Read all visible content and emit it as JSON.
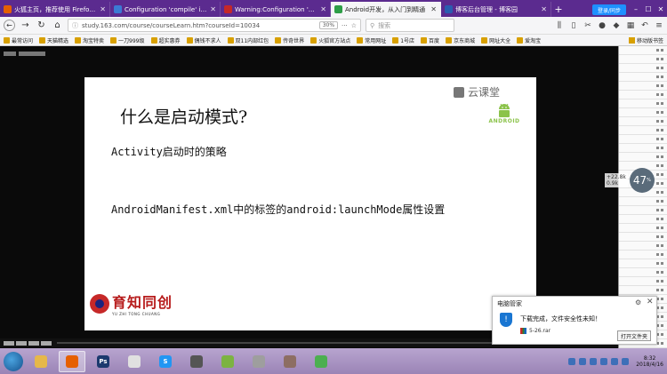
{
  "tabs": [
    {
      "label": "火狐主页，推荐使用 Firefox 浏",
      "color": "#e66000",
      "active": false
    },
    {
      "label": "Configuration 'compile' is ob",
      "color": "#3b7bd4",
      "active": false
    },
    {
      "label": "Warning:Configuration 'com",
      "color": "#c62828",
      "active": false
    },
    {
      "label": "Android开发，从入门到精通",
      "color": "#2e9e47",
      "active": true
    },
    {
      "label": "博客后台管理 - 博客园",
      "color": "#2a5db0",
      "active": false
    }
  ],
  "sync_label": "登录/同步",
  "address": {
    "url": "study.163.com/course/courseLearn.htm?courseId=10034",
    "zoom": "30%"
  },
  "search": {
    "placeholder": "搜索"
  },
  "bookmarks": [
    "最常访问",
    "天猫精选",
    "淘宝特卖",
    "一刀999级",
    "超实惠券",
    "偶钱不求人",
    "双11内部红包",
    "传奇世界",
    "火狐官方站点",
    "常用网址",
    "1号店",
    "百度",
    "京东商城",
    "网址大全",
    "爱淘宝"
  ],
  "bookmark_right": "移动版书签",
  "slide": {
    "title": "什么是启动模式?",
    "line1": "Activity启动时的策略",
    "line2": "AndroidManifest.xml中的标签的android:launchMode属性设置",
    "logo": "云课堂",
    "android_word": "ANDROID",
    "brand_cn": "育知同创",
    "brand_en": "YU ZHI TONG CHUANG"
  },
  "speed": {
    "up": "+22.8k",
    "down": "0.9k",
    "percent": "47",
    "unit": "%"
  },
  "notification": {
    "title": "电脑管家",
    "message": "下载完成，文件安全性未知！",
    "file": "5-26.rar",
    "open_button": "打开文件夹"
  },
  "taskbar": {
    "apps": [
      {
        "name": "explorer",
        "label": "",
        "color": "#e6b84a",
        "active": false
      },
      {
        "name": "firefox",
        "label": "",
        "color": "#e66000",
        "active": true
      },
      {
        "name": "photoshop",
        "label": "Ps",
        "color": "#1c3a6e",
        "active": false
      },
      {
        "name": "player",
        "label": "",
        "color": "#e0e0e0",
        "active": false
      },
      {
        "name": "sogou",
        "label": "S",
        "color": "#2196f3",
        "active": false
      },
      {
        "name": "app6",
        "label": "",
        "color": "#555",
        "active": false
      },
      {
        "name": "android-studio",
        "label": "",
        "color": "#7cb342",
        "active": false
      },
      {
        "name": "app8",
        "label": "",
        "color": "#9e9e9e",
        "active": false
      },
      {
        "name": "app9",
        "label": "",
        "color": "#8d6e63",
        "active": false
      },
      {
        "name": "wechat",
        "label": "",
        "color": "#4caf50",
        "active": false
      }
    ],
    "time": "8:32",
    "date": "2018/4/16"
  }
}
